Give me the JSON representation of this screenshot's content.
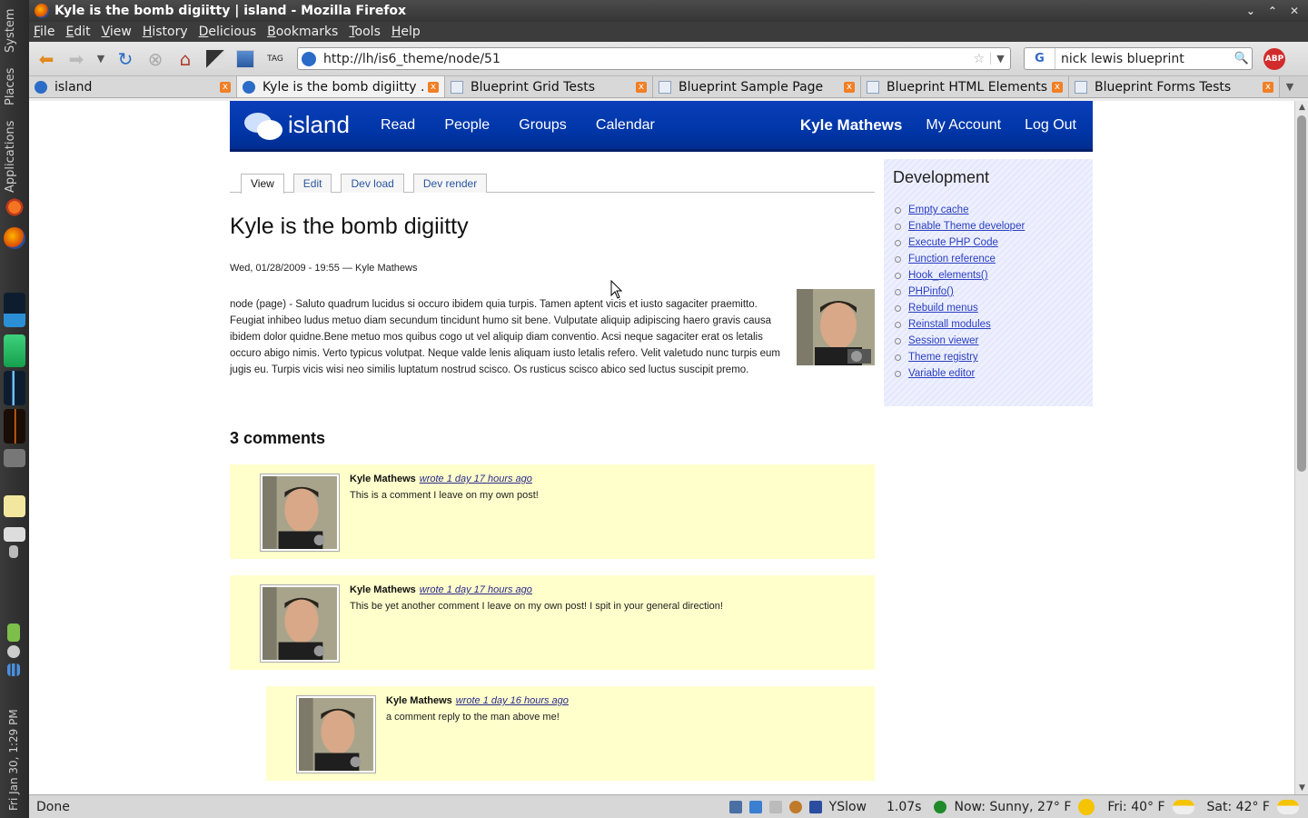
{
  "desktop": {
    "panel_labels": [
      "System",
      "Places",
      "Applications"
    ],
    "clock": "Fri Jan 30,  1:29 PM"
  },
  "window": {
    "title": "Kyle is the bomb digiitty | island - Mozilla Firefox",
    "menu": [
      "File",
      "Edit",
      "View",
      "History",
      "Delicious",
      "Bookmarks",
      "Tools",
      "Help"
    ],
    "url": "http://lh/is6_theme/node/51",
    "search_value": "nick lewis blueprint",
    "search_engine_icon": "G",
    "abp_label": "ABP"
  },
  "tabs": [
    {
      "label": "island",
      "active": false
    },
    {
      "label": "Kyle is the bomb digiitty ...",
      "active": true
    },
    {
      "label": "Blueprint Grid Tests",
      "active": false
    },
    {
      "label": "Blueprint Sample Page",
      "active": false
    },
    {
      "label": "Blueprint HTML Elements...",
      "active": false
    },
    {
      "label": "Blueprint Forms Tests",
      "active": false
    }
  ],
  "site": {
    "logo_text": "island",
    "nav": [
      "Read",
      "People",
      "Groups",
      "Calendar"
    ],
    "user_name": "Kyle Mathews",
    "user_links": [
      "My Account",
      "Log Out"
    ]
  },
  "local_tabs": [
    "View",
    "Edit",
    "Dev load",
    "Dev render"
  ],
  "node": {
    "title": "Kyle is the bomb digiitty",
    "submitted": "Wed, 01/28/2009 - 19:55 — Kyle Mathews",
    "body": "node (page) - Saluto quadrum lucidus si occuro ibidem quia turpis. Tamen aptent vicis et iusto sagaciter praemitto. Feugiat inhibeo ludus metuo diam secundum tincidunt humo sit bene. Vulputate aliquip adipiscing haero gravis causa ibidem dolor quidne.Bene metuo mos quibus cogo ut vel aliquip diam conventio. Acsi neque sagaciter erat os letalis occuro abigo nimis. Verto typicus volutpat. Neque valde lenis aliquam iusto letalis refero. Velit valetudo nunc turpis eum jugis eu. Turpis vicis wisi neo similis luptatum nostrud scisco. Os rusticus scisco abico sed luctus suscipit premo."
  },
  "comments_heading": "3 comments",
  "comments": [
    {
      "author": "Kyle Mathews",
      "when": "wrote 1 day 17 hours ago",
      "text": "This is a comment I leave on my own post!"
    },
    {
      "author": "Kyle Mathews",
      "when": "wrote 1 day 17 hours ago",
      "text": "This be yet another comment I leave on my own post! I spit in your general direction!"
    },
    {
      "author": "Kyle Mathews",
      "when": "wrote 1 day 16 hours ago",
      "text": "a comment reply to the man above me!"
    }
  ],
  "sidebar": {
    "title": "Development",
    "links": [
      "Empty cache",
      "Enable Theme developer",
      "Execute PHP Code",
      "Function reference",
      "Hook_elements()",
      "PHPinfo()",
      "Rebuild menus",
      "Reinstall modules",
      "Session viewer",
      "Theme registry",
      "Variable editor"
    ]
  },
  "status": {
    "text": "Done",
    "yslow": "YSlow",
    "load_time": "1.07s",
    "weather_now": "Now: Sunny, 27° F",
    "weather_fri": "Fri: 40° F",
    "weather_sat": "Sat: 42° F"
  },
  "colors": {
    "header_blue": "#0036a8",
    "comment_bg": "#ffffcc",
    "sidebar_bg": "#e8ebfd"
  }
}
